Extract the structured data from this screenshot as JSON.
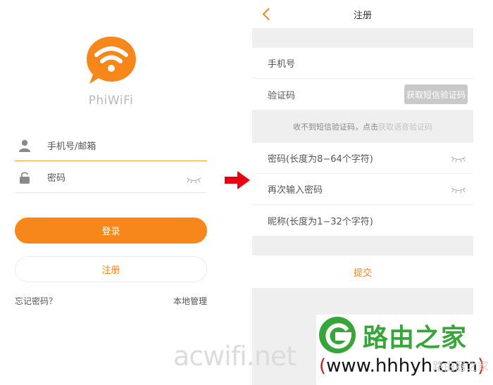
{
  "login": {
    "brand": "PhiWiFi",
    "phone_placeholder": "手机号/邮箱",
    "password_placeholder": "密码",
    "login_button": "登录",
    "register_button": "注册",
    "forgot_password": "忘记密码？",
    "local_manage": "本地管理"
  },
  "register": {
    "title": "注册",
    "phone_field": "手机号",
    "code_field": "验证码",
    "get_code_button": "获取短信验证码",
    "notice_prefix": "收不到短信验证码，点击",
    "notice_link": "获取语音验证码",
    "password_field": "密码(长度为8−64个字符)",
    "confirm_password_field": "再次输入密码",
    "nickname_field": "昵称(长度为1−32个字符)",
    "submit_button": "提交"
  },
  "watermark": {
    "url_text": "acwifi.net",
    "site_name": "路由之家",
    "site_url_open": "(",
    "site_url": "www.hhhyh.com",
    "site_url_close": ")",
    "site_small": "路由器之家"
  },
  "colors": {
    "accent": "#f7861b",
    "field_underline": "#f5a43a",
    "disabled_button": "#c9c9c9",
    "page_bg": "#efefef",
    "arrow": "#e60012",
    "watermark_green": "#37a639"
  },
  "icons": [
    "wifi-chat-logo",
    "user-icon",
    "lock-icon",
    "eye-closed-icon",
    "back-chevron-icon",
    "arrow-right-icon"
  ]
}
